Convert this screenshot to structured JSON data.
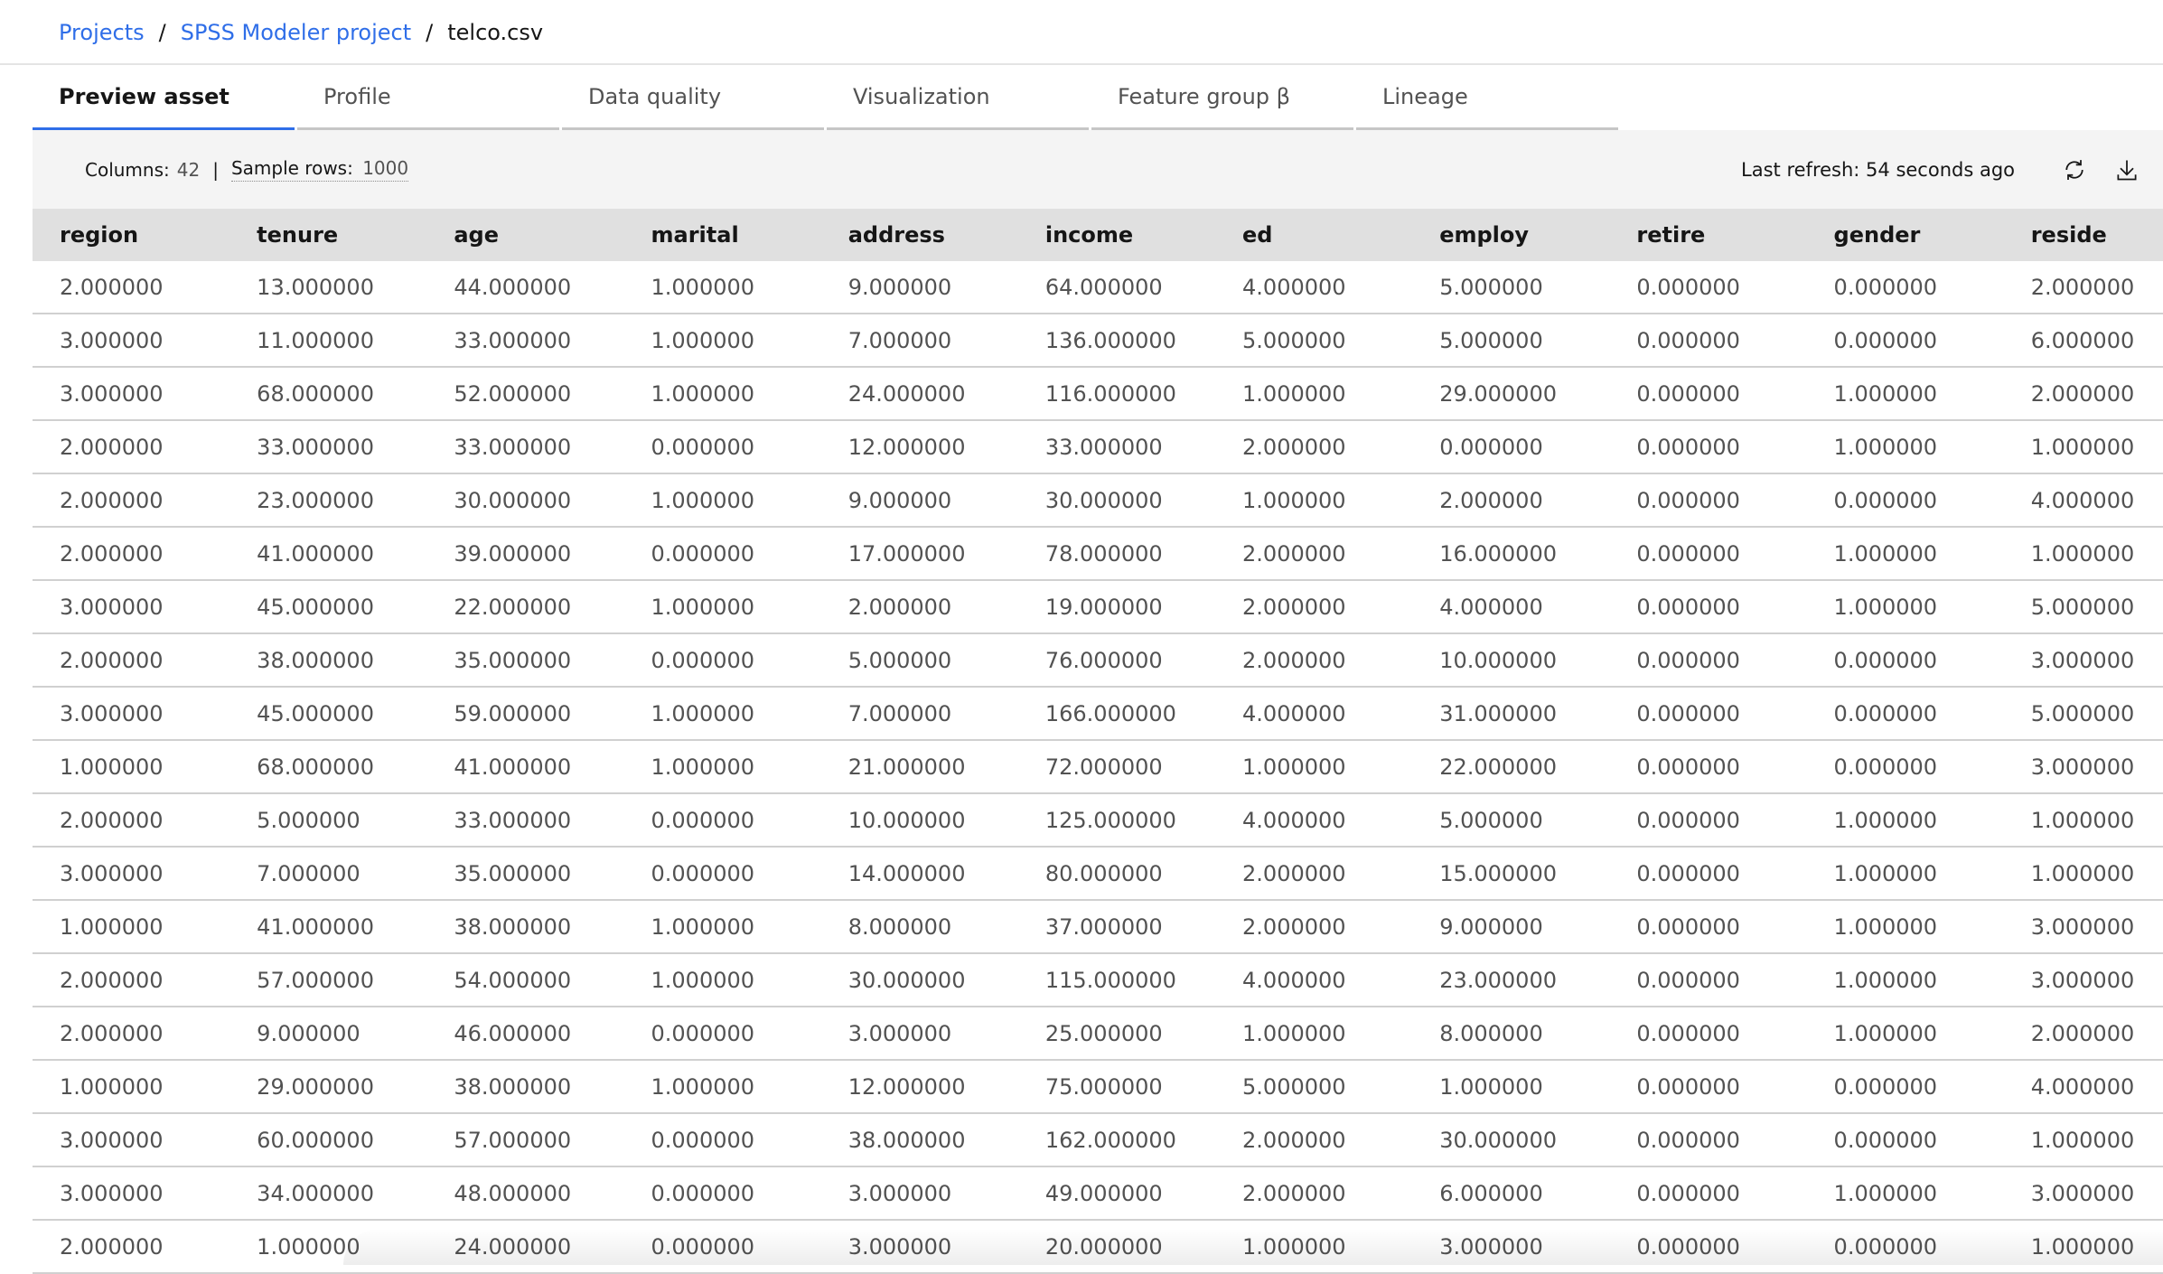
{
  "breadcrumb": {
    "items": [
      {
        "label": "Projects"
      },
      {
        "label": "SPSS Modeler project"
      }
    ],
    "separator": "/",
    "current": "telco.csv"
  },
  "tabs": [
    {
      "label": "Preview asset",
      "active": true
    },
    {
      "label": "Profile",
      "active": false
    },
    {
      "label": "Data quality",
      "active": false
    },
    {
      "label": "Visualization",
      "active": false
    },
    {
      "label": "Feature group β",
      "active": false
    },
    {
      "label": "Lineage",
      "active": false
    }
  ],
  "toolbar": {
    "columns_label": "Columns:",
    "columns_value": "42",
    "divider": "|",
    "sample_rows_label": "Sample rows:",
    "sample_rows_value": "1000",
    "last_refresh": "Last refresh: 54 seconds ago",
    "refresh_icon": "refresh-icon",
    "download_icon": "download-icon"
  },
  "table": {
    "columns": [
      "region",
      "tenure",
      "age",
      "marital",
      "address",
      "income",
      "ed",
      "employ",
      "retire",
      "gender",
      "reside"
    ],
    "rows": [
      [
        "2.000000",
        "13.000000",
        "44.000000",
        "1.000000",
        "9.000000",
        "64.000000",
        "4.000000",
        "5.000000",
        "0.000000",
        "0.000000",
        "2.000000"
      ],
      [
        "3.000000",
        "11.000000",
        "33.000000",
        "1.000000",
        "7.000000",
        "136.000000",
        "5.000000",
        "5.000000",
        "0.000000",
        "0.000000",
        "6.000000"
      ],
      [
        "3.000000",
        "68.000000",
        "52.000000",
        "1.000000",
        "24.000000",
        "116.000000",
        "1.000000",
        "29.000000",
        "0.000000",
        "1.000000",
        "2.000000"
      ],
      [
        "2.000000",
        "33.000000",
        "33.000000",
        "0.000000",
        "12.000000",
        "33.000000",
        "2.000000",
        "0.000000",
        "0.000000",
        "1.000000",
        "1.000000"
      ],
      [
        "2.000000",
        "23.000000",
        "30.000000",
        "1.000000",
        "9.000000",
        "30.000000",
        "1.000000",
        "2.000000",
        "0.000000",
        "0.000000",
        "4.000000"
      ],
      [
        "2.000000",
        "41.000000",
        "39.000000",
        "0.000000",
        "17.000000",
        "78.000000",
        "2.000000",
        "16.000000",
        "0.000000",
        "1.000000",
        "1.000000"
      ],
      [
        "3.000000",
        "45.000000",
        "22.000000",
        "1.000000",
        "2.000000",
        "19.000000",
        "2.000000",
        "4.000000",
        "0.000000",
        "1.000000",
        "5.000000"
      ],
      [
        "2.000000",
        "38.000000",
        "35.000000",
        "0.000000",
        "5.000000",
        "76.000000",
        "2.000000",
        "10.000000",
        "0.000000",
        "0.000000",
        "3.000000"
      ],
      [
        "3.000000",
        "45.000000",
        "59.000000",
        "1.000000",
        "7.000000",
        "166.000000",
        "4.000000",
        "31.000000",
        "0.000000",
        "0.000000",
        "5.000000"
      ],
      [
        "1.000000",
        "68.000000",
        "41.000000",
        "1.000000",
        "21.000000",
        "72.000000",
        "1.000000",
        "22.000000",
        "0.000000",
        "0.000000",
        "3.000000"
      ],
      [
        "2.000000",
        "5.000000",
        "33.000000",
        "0.000000",
        "10.000000",
        "125.000000",
        "4.000000",
        "5.000000",
        "0.000000",
        "1.000000",
        "1.000000"
      ],
      [
        "3.000000",
        "7.000000",
        "35.000000",
        "0.000000",
        "14.000000",
        "80.000000",
        "2.000000",
        "15.000000",
        "0.000000",
        "1.000000",
        "1.000000"
      ],
      [
        "1.000000",
        "41.000000",
        "38.000000",
        "1.000000",
        "8.000000",
        "37.000000",
        "2.000000",
        "9.000000",
        "0.000000",
        "1.000000",
        "3.000000"
      ],
      [
        "2.000000",
        "57.000000",
        "54.000000",
        "1.000000",
        "30.000000",
        "115.000000",
        "4.000000",
        "23.000000",
        "0.000000",
        "1.000000",
        "3.000000"
      ],
      [
        "2.000000",
        "9.000000",
        "46.000000",
        "0.000000",
        "3.000000",
        "25.000000",
        "1.000000",
        "8.000000",
        "0.000000",
        "1.000000",
        "2.000000"
      ],
      [
        "1.000000",
        "29.000000",
        "38.000000",
        "1.000000",
        "12.000000",
        "75.000000",
        "5.000000",
        "1.000000",
        "0.000000",
        "0.000000",
        "4.000000"
      ],
      [
        "3.000000",
        "60.000000",
        "57.000000",
        "0.000000",
        "38.000000",
        "162.000000",
        "2.000000",
        "30.000000",
        "0.000000",
        "0.000000",
        "1.000000"
      ],
      [
        "3.000000",
        "34.000000",
        "48.000000",
        "0.000000",
        "3.000000",
        "49.000000",
        "2.000000",
        "6.000000",
        "0.000000",
        "1.000000",
        "3.000000"
      ],
      [
        "2.000000",
        "1.000000",
        "24.000000",
        "0.000000",
        "3.000000",
        "20.000000",
        "1.000000",
        "3.000000",
        "0.000000",
        "0.000000",
        "1.000000"
      ]
    ]
  },
  "colors": {
    "accent": "#2f6ee8",
    "toolbar_bg": "#f4f4f4",
    "header_bg": "#e0e0e0",
    "tab_inactive_border": "#c6c6c6",
    "cell_text": "#525252"
  }
}
